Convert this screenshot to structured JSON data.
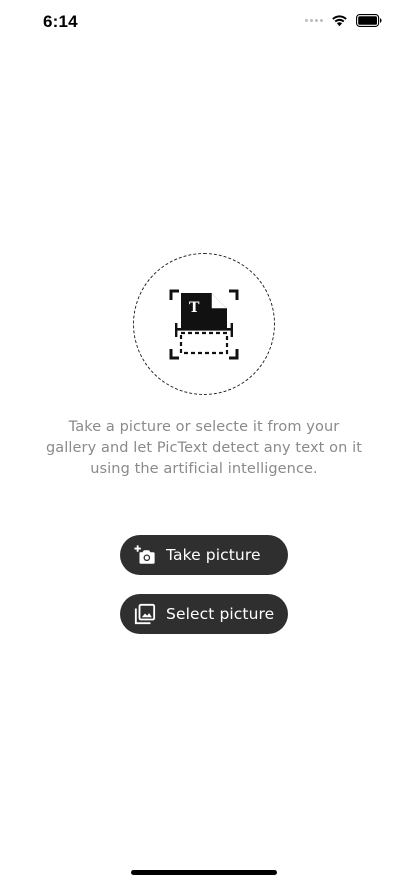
{
  "status_bar": {
    "time": "6:14"
  },
  "hero": {
    "icon": "scan-document-icon",
    "glyph": "T"
  },
  "description": "Take a picture or selecte it from your gallery and let PicText detect any text on it using the artificial intelligence.",
  "actions": {
    "take_picture": {
      "label": "Take picture",
      "icon": "add-camera-icon"
    },
    "select_picture": {
      "label": "Select picture",
      "icon": "photo-library-icon"
    }
  },
  "colors": {
    "button_bg": "#2f2f2f",
    "button_text": "#ffffff",
    "description_text": "#8a8a8a"
  }
}
